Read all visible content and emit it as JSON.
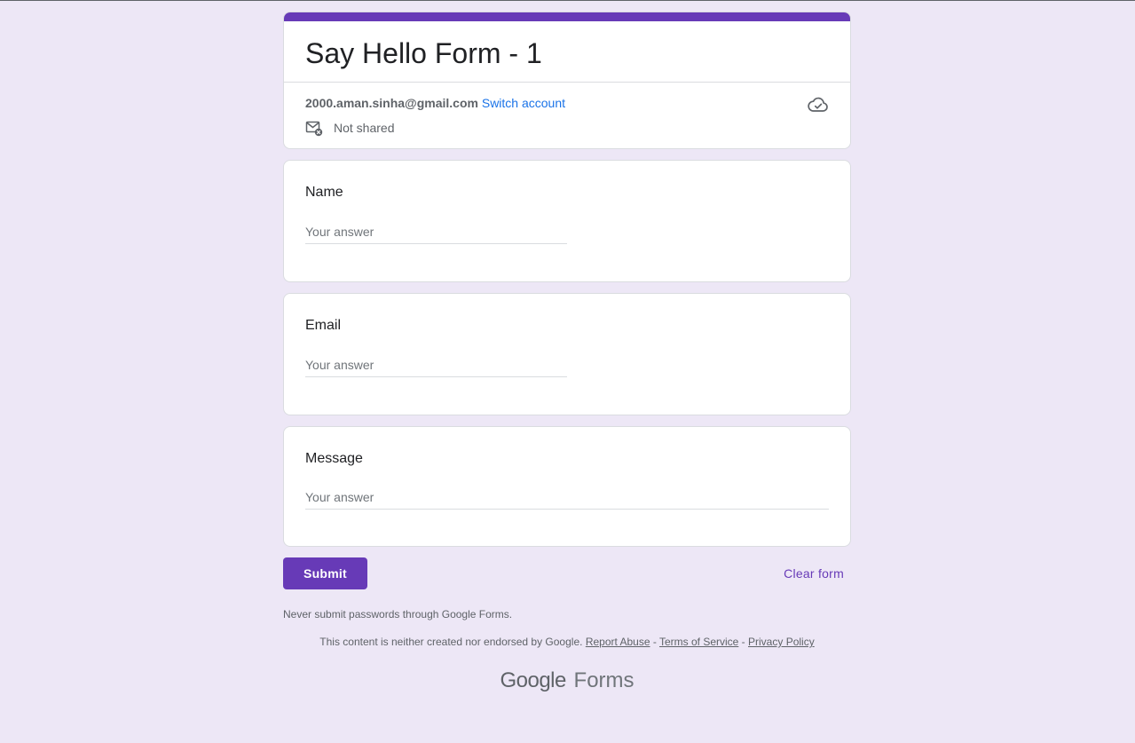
{
  "form": {
    "title": "Say Hello Form - 1",
    "accent_color": "#673ab7",
    "background_color": "#ede7f6"
  },
  "account": {
    "email": "2000.aman.sinha@gmail.com",
    "switch_label": "Switch account",
    "shared_status": "Not shared",
    "shared_icon": "mail-not-shared-icon",
    "save_status_icon": "cloud-done-icon"
  },
  "questions": [
    {
      "label": "Name",
      "placeholder": "Your answer"
    },
    {
      "label": "Email",
      "placeholder": "Your answer"
    },
    {
      "label": "Message",
      "placeholder": "Your answer"
    }
  ],
  "actions": {
    "submit_label": "Submit",
    "clear_label": "Clear form"
  },
  "footer": {
    "warning": "Never submit passwords through Google Forms.",
    "disclaimer": "This content is neither created nor endorsed by Google.",
    "report_abuse": "Report Abuse",
    "separator": " - ",
    "terms": "Terms of Service",
    "privacy": "Privacy Policy",
    "logo_google": "Google",
    "logo_forms": "Forms"
  }
}
